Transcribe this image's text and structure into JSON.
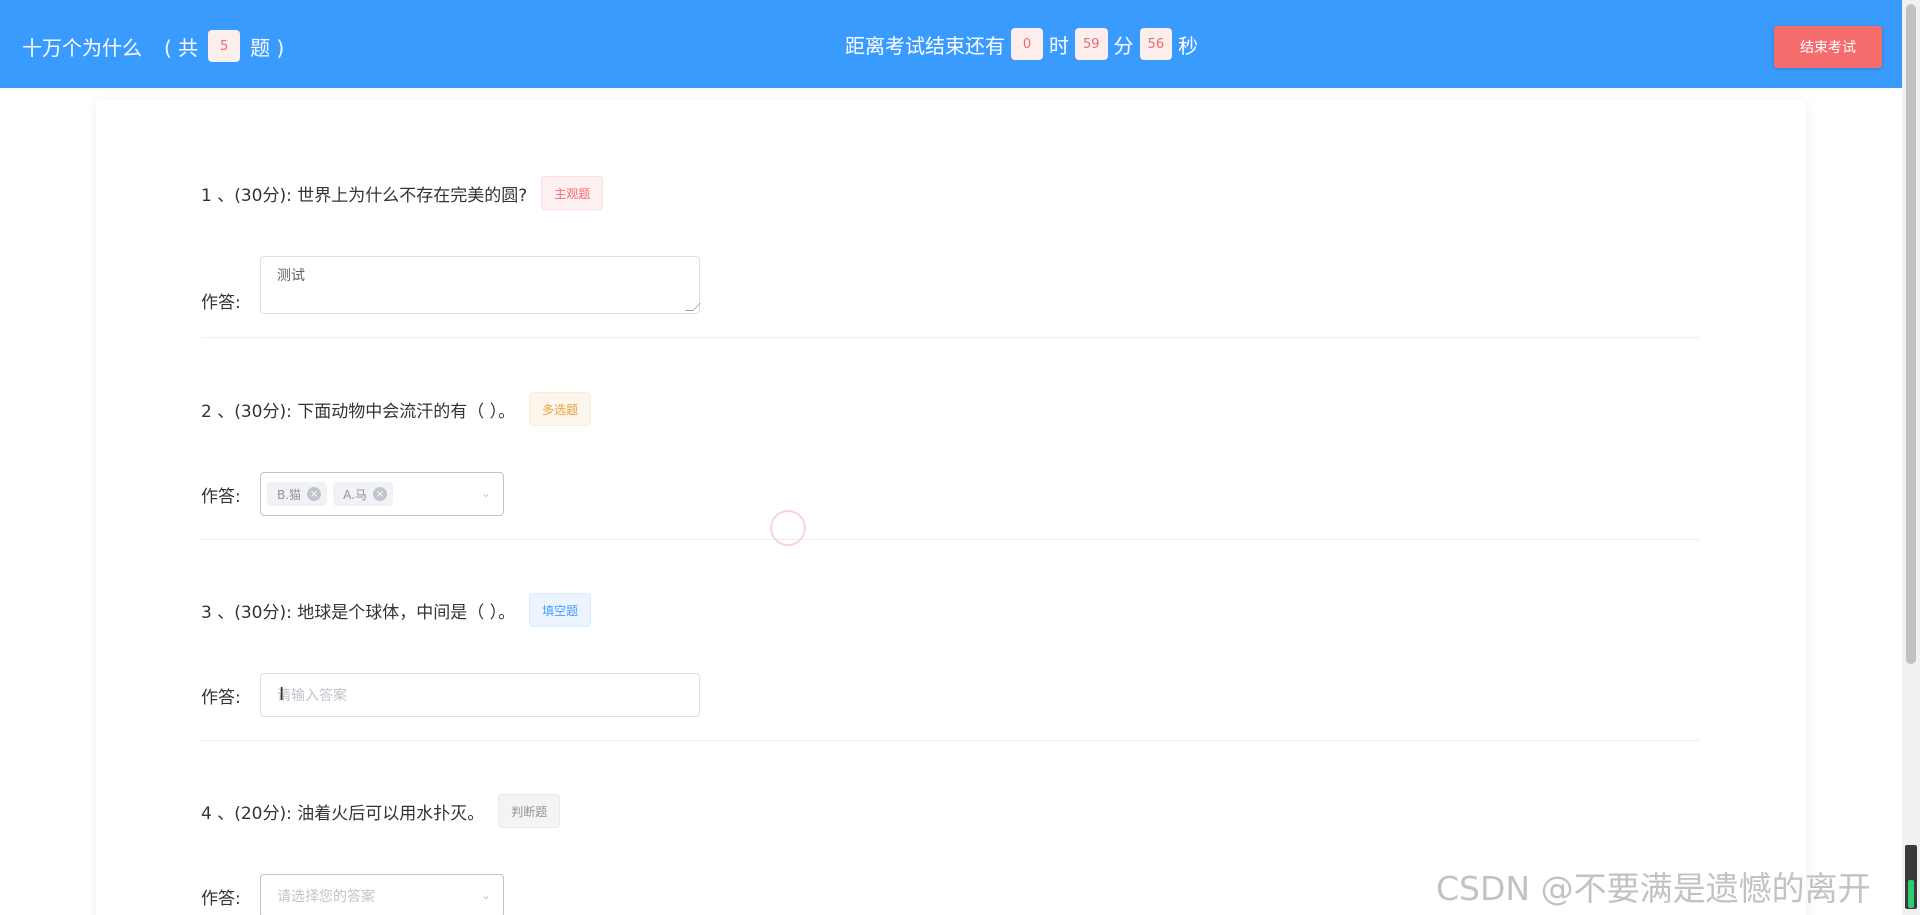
{
  "header": {
    "title": "十万个为什么",
    "count_prefix": "( 共",
    "count": "5",
    "count_suffix": "题 )",
    "timer_prefix": "距离考试结束还有",
    "hours": "0",
    "hours_unit": "时",
    "minutes": "59",
    "minutes_unit": "分",
    "seconds": "56",
    "seconds_unit": "秒",
    "end_button": "结束考试"
  },
  "answer_label": "作答:",
  "questions": [
    {
      "text": "1 、(30分): 世界上为什么不存在完美的圆?",
      "tag": "主观题",
      "answer_value": "测试"
    },
    {
      "text": "2 、(30分): 下面动物中会流汗的有（ ）。",
      "tag": "多选题",
      "chips": [
        "B.猫",
        "A.马"
      ]
    },
    {
      "text": "3 、(30分): 地球是个球体，中间是（ ）。",
      "tag": "填空题",
      "placeholder": "请输入答案"
    },
    {
      "text": "4 、(20分): 油着火后可以用水扑灭。",
      "tag": "判断题",
      "placeholder": "请选择您的答案"
    }
  ],
  "watermark": "CSDN @不要满是遗憾的离开",
  "colors": {
    "header_bg": "#3a9bff",
    "end_button_bg": "#f56c6c"
  }
}
